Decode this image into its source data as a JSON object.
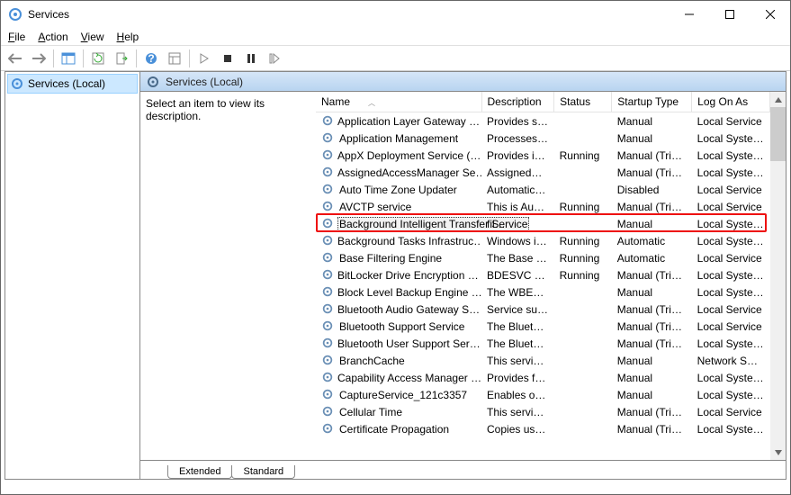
{
  "window": {
    "title": "Services"
  },
  "menu": {
    "file": "File",
    "action": "Action",
    "view": "View",
    "help": "Help"
  },
  "tree": {
    "root": "Services (Local)"
  },
  "panel": {
    "header": "Services (Local)",
    "description_placeholder": "Select an item to view its description."
  },
  "columns": {
    "name": "Name",
    "description": "Description",
    "status": "Status",
    "startup": "Startup Type",
    "logon": "Log On As"
  },
  "highlighted_service": "Background Intelligent Transfer Service",
  "services": [
    {
      "name": "Application Layer Gateway …",
      "desc": "Provides su…",
      "status": "",
      "startup": "Manual",
      "logon": "Local Service"
    },
    {
      "name": "Application Management",
      "desc": "Processes in…",
      "status": "",
      "startup": "Manual",
      "logon": "Local Syste…"
    },
    {
      "name": "AppX Deployment Service (…",
      "desc": "Provides inf…",
      "status": "Running",
      "startup": "Manual (Trig…",
      "logon": "Local Syste…"
    },
    {
      "name": "AssignedAccessManager Se…",
      "desc": "AssignedAc…",
      "status": "",
      "startup": "Manual (Trig…",
      "logon": "Local Syste…"
    },
    {
      "name": "Auto Time Zone Updater",
      "desc": "Automatica…",
      "status": "",
      "startup": "Disabled",
      "logon": "Local Service"
    },
    {
      "name": "AVCTP service",
      "desc": "This is Audi…",
      "status": "Running",
      "startup": "Manual (Trig…",
      "logon": "Local Service"
    },
    {
      "name": "Background Intelligent Transfer Service",
      "desc": "fil…",
      "status": "",
      "startup": "Manual",
      "logon": "Local Syste…",
      "highlight": true
    },
    {
      "name": "Background Tasks Infrastruc…",
      "desc": "Windows in…",
      "status": "Running",
      "startup": "Automatic",
      "logon": "Local Syste…"
    },
    {
      "name": "Base Filtering Engine",
      "desc": "The Base Fil…",
      "status": "Running",
      "startup": "Automatic",
      "logon": "Local Service"
    },
    {
      "name": "BitLocker Drive Encryption …",
      "desc": "BDESVC hos…",
      "status": "Running",
      "startup": "Manual (Trig…",
      "logon": "Local Syste…"
    },
    {
      "name": "Block Level Backup Engine …",
      "desc": "The WBENG…",
      "status": "",
      "startup": "Manual",
      "logon": "Local Syste…"
    },
    {
      "name": "Bluetooth Audio Gateway S…",
      "desc": "Service sup…",
      "status": "",
      "startup": "Manual (Trig…",
      "logon": "Local Service"
    },
    {
      "name": "Bluetooth Support Service",
      "desc": "The Bluetoo…",
      "status": "",
      "startup": "Manual (Trig…",
      "logon": "Local Service"
    },
    {
      "name": "Bluetooth User Support Ser…",
      "desc": "The Bluetoo…",
      "status": "",
      "startup": "Manual (Trig…",
      "logon": "Local Syste…"
    },
    {
      "name": "BranchCache",
      "desc": "This service …",
      "status": "",
      "startup": "Manual",
      "logon": "Network S…"
    },
    {
      "name": "Capability Access Manager …",
      "desc": "Provides fac…",
      "status": "",
      "startup": "Manual",
      "logon": "Local Syste…"
    },
    {
      "name": "CaptureService_121c3357",
      "desc": "Enables opti…",
      "status": "",
      "startup": "Manual",
      "logon": "Local Syste…"
    },
    {
      "name": "Cellular Time",
      "desc": "This service …",
      "status": "",
      "startup": "Manual (Trig…",
      "logon": "Local Service"
    },
    {
      "name": "Certificate Propagation",
      "desc": "Copies user …",
      "status": "",
      "startup": "Manual (Trig…",
      "logon": "Local Syste…"
    }
  ],
  "tabs": {
    "extended": "Extended",
    "standard": "Standard"
  }
}
